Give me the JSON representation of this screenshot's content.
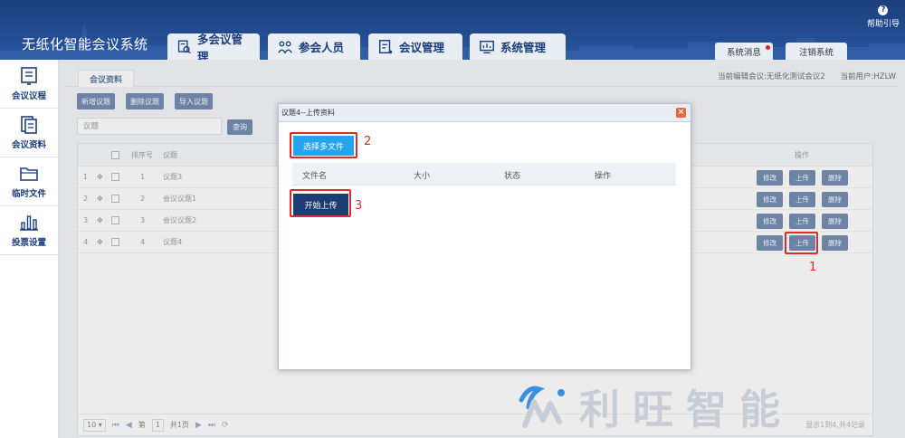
{
  "app": {
    "title": "无纸化智能会议系统"
  },
  "nav": [
    {
      "label": "多会议管理",
      "icon": "multi-meeting-icon"
    },
    {
      "label": "参会人员",
      "icon": "attendees-icon"
    },
    {
      "label": "会议管理",
      "icon": "meeting-manage-icon"
    },
    {
      "label": "系统管理",
      "icon": "system-manage-icon"
    }
  ],
  "header": {
    "messages_label": "系统消息",
    "logout_label": "注销系统",
    "help_label": "帮助引导"
  },
  "sidebar": {
    "items": [
      {
        "label": "会议议程",
        "icon": "agenda-icon"
      },
      {
        "label": "会议资料",
        "icon": "documents-icon"
      },
      {
        "label": "临时文件",
        "icon": "folder-icon"
      },
      {
        "label": "投票设置",
        "icon": "vote-chart-icon"
      }
    ]
  },
  "tab": {
    "active": "会议资料"
  },
  "status": {
    "meeting": "当前编辑会议:无纸化测试会议2",
    "user": "当前用户:HZLW"
  },
  "toolbar": {
    "add": "新增议题",
    "delete": "删除议题",
    "import": "导入议题"
  },
  "search": {
    "placeholder": "议题",
    "button": "查询"
  },
  "grid": {
    "headers": {
      "order": "排序号",
      "topic": "议题",
      "ops": "操作"
    },
    "rows": [
      {
        "num": "1",
        "order": "1",
        "topic": "议题3"
      },
      {
        "num": "2",
        "order": "2",
        "topic": "会议议题1"
      },
      {
        "num": "3",
        "order": "3",
        "topic": "会议议题2"
      },
      {
        "num": "4",
        "order": "4",
        "topic": "议题4"
      }
    ],
    "ops": {
      "edit": "修改",
      "upload": "上传",
      "delete": "删除"
    }
  },
  "pager": {
    "page_size": "10",
    "page_prefix": "第",
    "page": "1",
    "page_total": "共1页",
    "right": "显示1到4,共4记录"
  },
  "modal": {
    "title": "议题4--上传资料",
    "choose": "选择多文件",
    "columns": [
      "文件名",
      "大小",
      "状态",
      "操作"
    ],
    "start": "开始上传"
  },
  "annotations": [
    "1",
    "2",
    "3"
  ],
  "watermark": {
    "text": "利旺智能"
  },
  "colors": {
    "brand": "#1d3f7e",
    "button": "#3c5f93",
    "choose": "#24a3ee",
    "highlight": "#e12a2a"
  }
}
